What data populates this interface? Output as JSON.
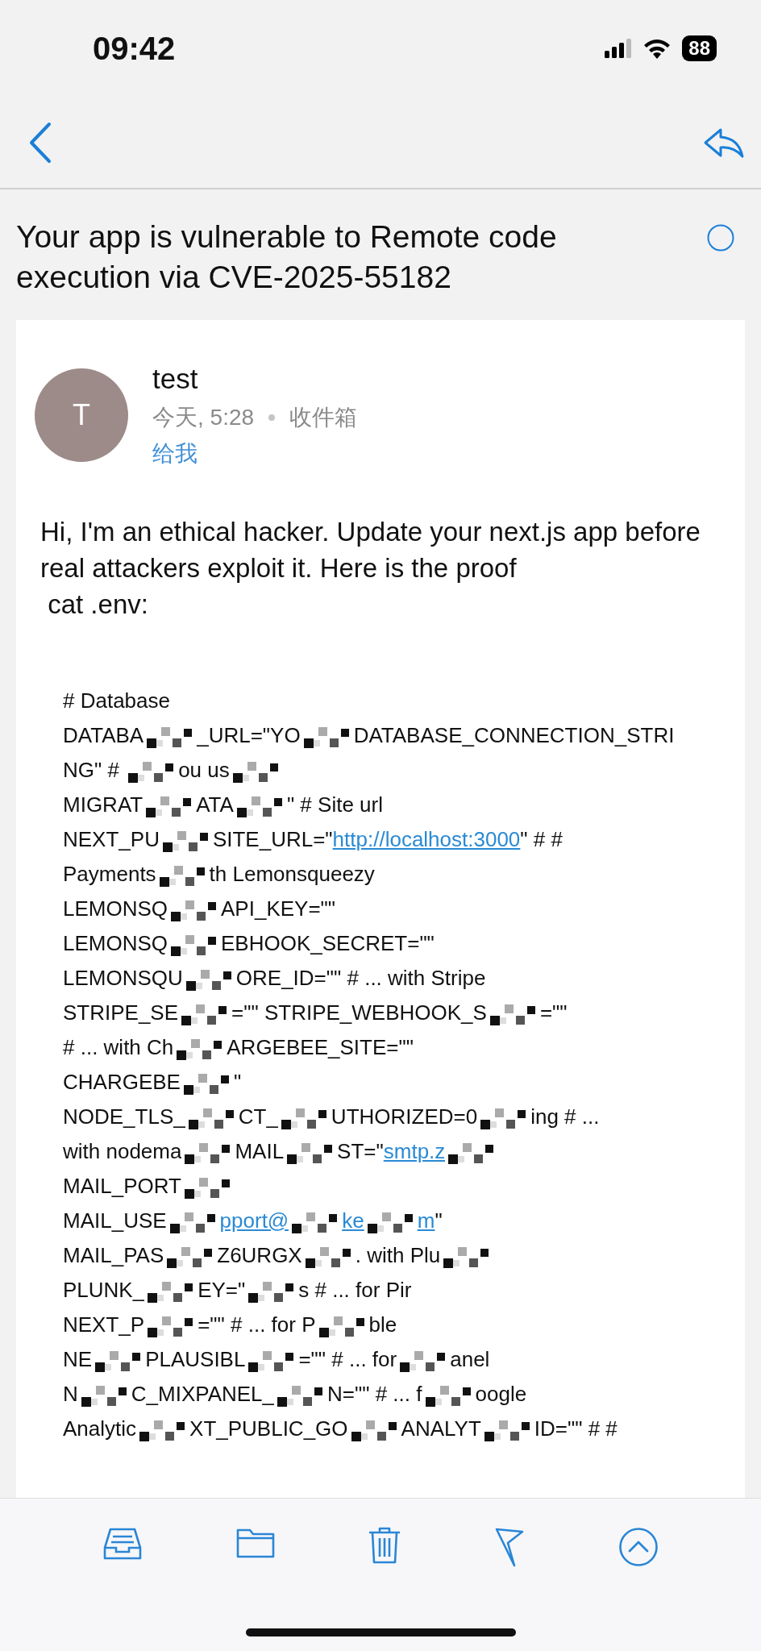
{
  "status_bar": {
    "time": "09:42",
    "battery": "88"
  },
  "subject": "Your app is vulnerable to Remote code execution via CVE-2025-55182",
  "message": {
    "avatar": "T",
    "sender": "test",
    "date": "今天, 5:28",
    "mailbox": "收件箱",
    "recipient": "给我",
    "intro": "Hi, I'm an ethical hacker. Update your next.js app before real attackers exploit it. Here is the proof",
    "command": " cat .env:",
    "code_lines": [
      [
        {
          "kind": "text",
          "text": "# Database"
        }
      ],
      [
        {
          "kind": "text",
          "text": "DATABA"
        },
        {
          "kind": "redacted"
        },
        {
          "kind": "text",
          "text": "_URL=\"YO"
        },
        {
          "kind": "redacted"
        },
        {
          "kind": "text",
          "text": "DATABASE_CONNECTION_STRI"
        }
      ],
      [
        {
          "kind": "text",
          "text": "NG\" # "
        },
        {
          "kind": "redacted"
        },
        {
          "kind": "text",
          "text": "ou us"
        },
        {
          "kind": "redacted"
        }
      ],
      [
        {
          "kind": "text",
          "text": "MIGRAT"
        },
        {
          "kind": "redacted"
        },
        {
          "kind": "text",
          "text": "ATA"
        },
        {
          "kind": "redacted"
        },
        {
          "kind": "text",
          "text": "\" # Site url"
        }
      ],
      [
        {
          "kind": "text",
          "text": "NEXT_PU"
        },
        {
          "kind": "redacted"
        },
        {
          "kind": "text",
          "text": "SITE_URL=\""
        },
        {
          "kind": "link",
          "text": "http://localhost:3000"
        },
        {
          "kind": "text",
          "text": "\" # #"
        }
      ],
      [
        {
          "kind": "text",
          "text": "Payments"
        },
        {
          "kind": "redacted"
        },
        {
          "kind": "text",
          "text": "th Lemonsqueezy"
        }
      ],
      [
        {
          "kind": "text",
          "text": "LEMONSQ"
        },
        {
          "kind": "redacted"
        },
        {
          "kind": "text",
          "text": "API_KEY=\"\""
        }
      ],
      [
        {
          "kind": "text",
          "text": "LEMONSQ"
        },
        {
          "kind": "redacted"
        },
        {
          "kind": "text",
          "text": "EBHOOK_SECRET=\"\""
        }
      ],
      [
        {
          "kind": "text",
          "text": "LEMONSQU"
        },
        {
          "kind": "redacted"
        },
        {
          "kind": "text",
          "text": "ORE_ID=\"\" # ... with Stripe"
        }
      ],
      [
        {
          "kind": "text",
          "text": "STRIPE_SE"
        },
        {
          "kind": "redacted"
        },
        {
          "kind": "text",
          "text": "=\"\" STRIPE_WEBHOOK_S"
        },
        {
          "kind": "redacted"
        },
        {
          "kind": "text",
          "text": "=\"\""
        }
      ],
      [
        {
          "kind": "text",
          "text": "# ... with Ch"
        },
        {
          "kind": "redacted"
        },
        {
          "kind": "text",
          "text": "ARGEBEE_SITE=\"\""
        }
      ],
      [
        {
          "kind": "text",
          "text": "CHARGEBE"
        },
        {
          "kind": "redacted"
        },
        {
          "kind": "text",
          "text": "\""
        }
      ],
      [
        {
          "kind": "text",
          "text": "NODE_TLS_"
        },
        {
          "kind": "redacted"
        },
        {
          "kind": "text",
          "text": "CT_"
        },
        {
          "kind": "redacted"
        },
        {
          "kind": "text",
          "text": "UTHORIZED=0"
        },
        {
          "kind": "redacted"
        },
        {
          "kind": "text",
          "text": "ing # ..."
        }
      ],
      [
        {
          "kind": "text",
          "text": "with nodema"
        },
        {
          "kind": "redacted"
        },
        {
          "kind": "text",
          "text": "MAIL"
        },
        {
          "kind": "redacted"
        },
        {
          "kind": "text",
          "text": "ST=\""
        },
        {
          "kind": "link",
          "text": "smtp.z"
        },
        {
          "kind": "redacted"
        }
      ],
      [
        {
          "kind": "text",
          "text": "MAIL_PORT"
        },
        {
          "kind": "redacted"
        }
      ],
      [
        {
          "kind": "text",
          "text": "MAIL_USE"
        },
        {
          "kind": "redacted"
        },
        {
          "kind": "link",
          "text": "pport@"
        },
        {
          "kind": "redacted"
        },
        {
          "kind": "link",
          "text": "ke"
        },
        {
          "kind": "redacted"
        },
        {
          "kind": "link",
          "text": "m"
        },
        {
          "kind": "text",
          "text": "\""
        }
      ],
      [
        {
          "kind": "text",
          "text": "MAIL_PAS"
        },
        {
          "kind": "redacted"
        },
        {
          "kind": "text",
          "text": "Z6URGX"
        },
        {
          "kind": "redacted"
        },
        {
          "kind": "text",
          "text": ". with Plu"
        },
        {
          "kind": "redacted"
        }
      ],
      [
        {
          "kind": "text",
          "text": "PLUNK_"
        },
        {
          "kind": "redacted"
        },
        {
          "kind": "text",
          "text": "EY=\""
        },
        {
          "kind": "redacted"
        },
        {
          "kind": "text",
          "text": "s # ... for Pir"
        }
      ],
      [
        {
          "kind": "text",
          "text": "NEXT_P"
        },
        {
          "kind": "redacted"
        },
        {
          "kind": "text",
          "text": "=\"\" # ... for P"
        },
        {
          "kind": "redacted"
        },
        {
          "kind": "text",
          "text": "ble"
        }
      ],
      [
        {
          "kind": "text",
          "text": "NE"
        },
        {
          "kind": "redacted"
        },
        {
          "kind": "text",
          "text": "PLAUSIBL"
        },
        {
          "kind": "redacted"
        },
        {
          "kind": "text",
          "text": "=\"\" # ... for"
        },
        {
          "kind": "redacted"
        },
        {
          "kind": "text",
          "text": "anel"
        }
      ],
      [
        {
          "kind": "text",
          "text": "N"
        },
        {
          "kind": "redacted"
        },
        {
          "kind": "text",
          "text": "C_MIXPANEL_"
        },
        {
          "kind": "redacted"
        },
        {
          "kind": "text",
          "text": "N=\"\" # ... f"
        },
        {
          "kind": "redacted"
        },
        {
          "kind": "text",
          "text": "oogle"
        }
      ],
      [
        {
          "kind": "text",
          "text": "Analytic"
        },
        {
          "kind": "redacted"
        },
        {
          "kind": "text",
          "text": "XT_PUBLIC_GO"
        },
        {
          "kind": "redacted"
        },
        {
          "kind": "text",
          "text": "ANALYT"
        },
        {
          "kind": "redacted"
        },
        {
          "kind": "text",
          "text": "ID=\"\" # #"
        }
      ]
    ]
  }
}
